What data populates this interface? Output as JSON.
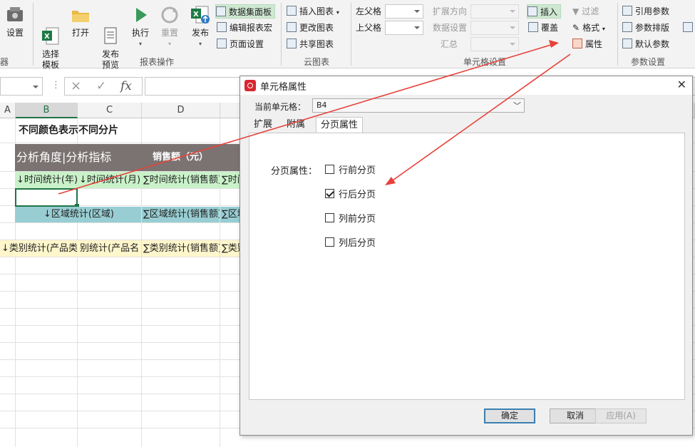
{
  "ribbon": {
    "big_buttons": [
      {
        "label": "设置",
        "icon": "gear-icon"
      },
      {
        "label": "选择\n模板",
        "icon": "excel-template-icon"
      },
      {
        "label": "打开",
        "icon": "folder-icon"
      },
      {
        "label": "发布\n预览",
        "icon": "document-preview-icon"
      },
      {
        "label": "执行",
        "icon": "play-icon"
      },
      {
        "label": "重置",
        "icon": "refresh-icon"
      },
      {
        "label": "发布",
        "icon": "excel-publish-icon"
      }
    ],
    "small": {
      "dataset_panel": "数据集面板",
      "edit_macro": "编辑报表宏",
      "page_setup": "页面设置",
      "insert_chart": "插入图表",
      "change_chart": "更改图表",
      "share_chart": "共享图表",
      "left_parent": "左父格",
      "top_parent": "上父格",
      "expand_direction": "扩展方向",
      "data_setting": "数据设置",
      "summary": "汇总",
      "insert": "插入",
      "overwrite": "覆盖",
      "filter": "过滤",
      "format": "格式",
      "properties": "属性",
      "ref_params": "引用参数",
      "param_layout": "参数排版",
      "default_params": "默认参数"
    },
    "groups": {
      "first_partial": "器",
      "report_ops": "报表操作",
      "cloud_chart": "云图表",
      "cell_settings": "单元格设置",
      "param_settings": "参数设置"
    }
  },
  "formula_bar": {
    "cancel_icon": "×",
    "confirm_icon": "✓",
    "fx": "fx"
  },
  "sheet": {
    "columns": [
      "A",
      "B",
      "C",
      "D"
    ],
    "title": "不同颜色表示不同分片",
    "header_left": "分析角度|分析指标",
    "header_right": "销售额（元）",
    "row_time": [
      "↓时间统计(年)",
      "↓时间统计(月)",
      "∑时间统计(销售额)",
      "∑时间"
    ],
    "row_region": [
      "↓区域统计(区域)",
      "∑区域统计(销售额)",
      "∑区域"
    ],
    "row_category": [
      "↓类别统计(产品类",
      "别统计(产品名",
      "∑类别统计(销售额)",
      "∑类别"
    ]
  },
  "dialog": {
    "title": "单元格属性",
    "close": "✕",
    "current_cell_label": "当前单元格：",
    "current_cell_value": "B4",
    "tabs": [
      "扩展",
      "附属",
      "分页属性"
    ],
    "paging_label": "分页属性：",
    "options": [
      {
        "label": "行前分页",
        "checked": false
      },
      {
        "label": "行后分页",
        "checked": true
      },
      {
        "label": "列前分页",
        "checked": false
      },
      {
        "label": "列后分页",
        "checked": false
      }
    ],
    "buttons": {
      "ok": "确定",
      "cancel": "取消",
      "apply": "应用(A)"
    }
  },
  "colors": {
    "accent_green": "#217346",
    "annotation_red": "#e8413a",
    "header_dark": "#7b7372",
    "time_green": "#c9f2c9",
    "region_teal": "#98ced3",
    "category_yellow": "#fff6cc"
  }
}
